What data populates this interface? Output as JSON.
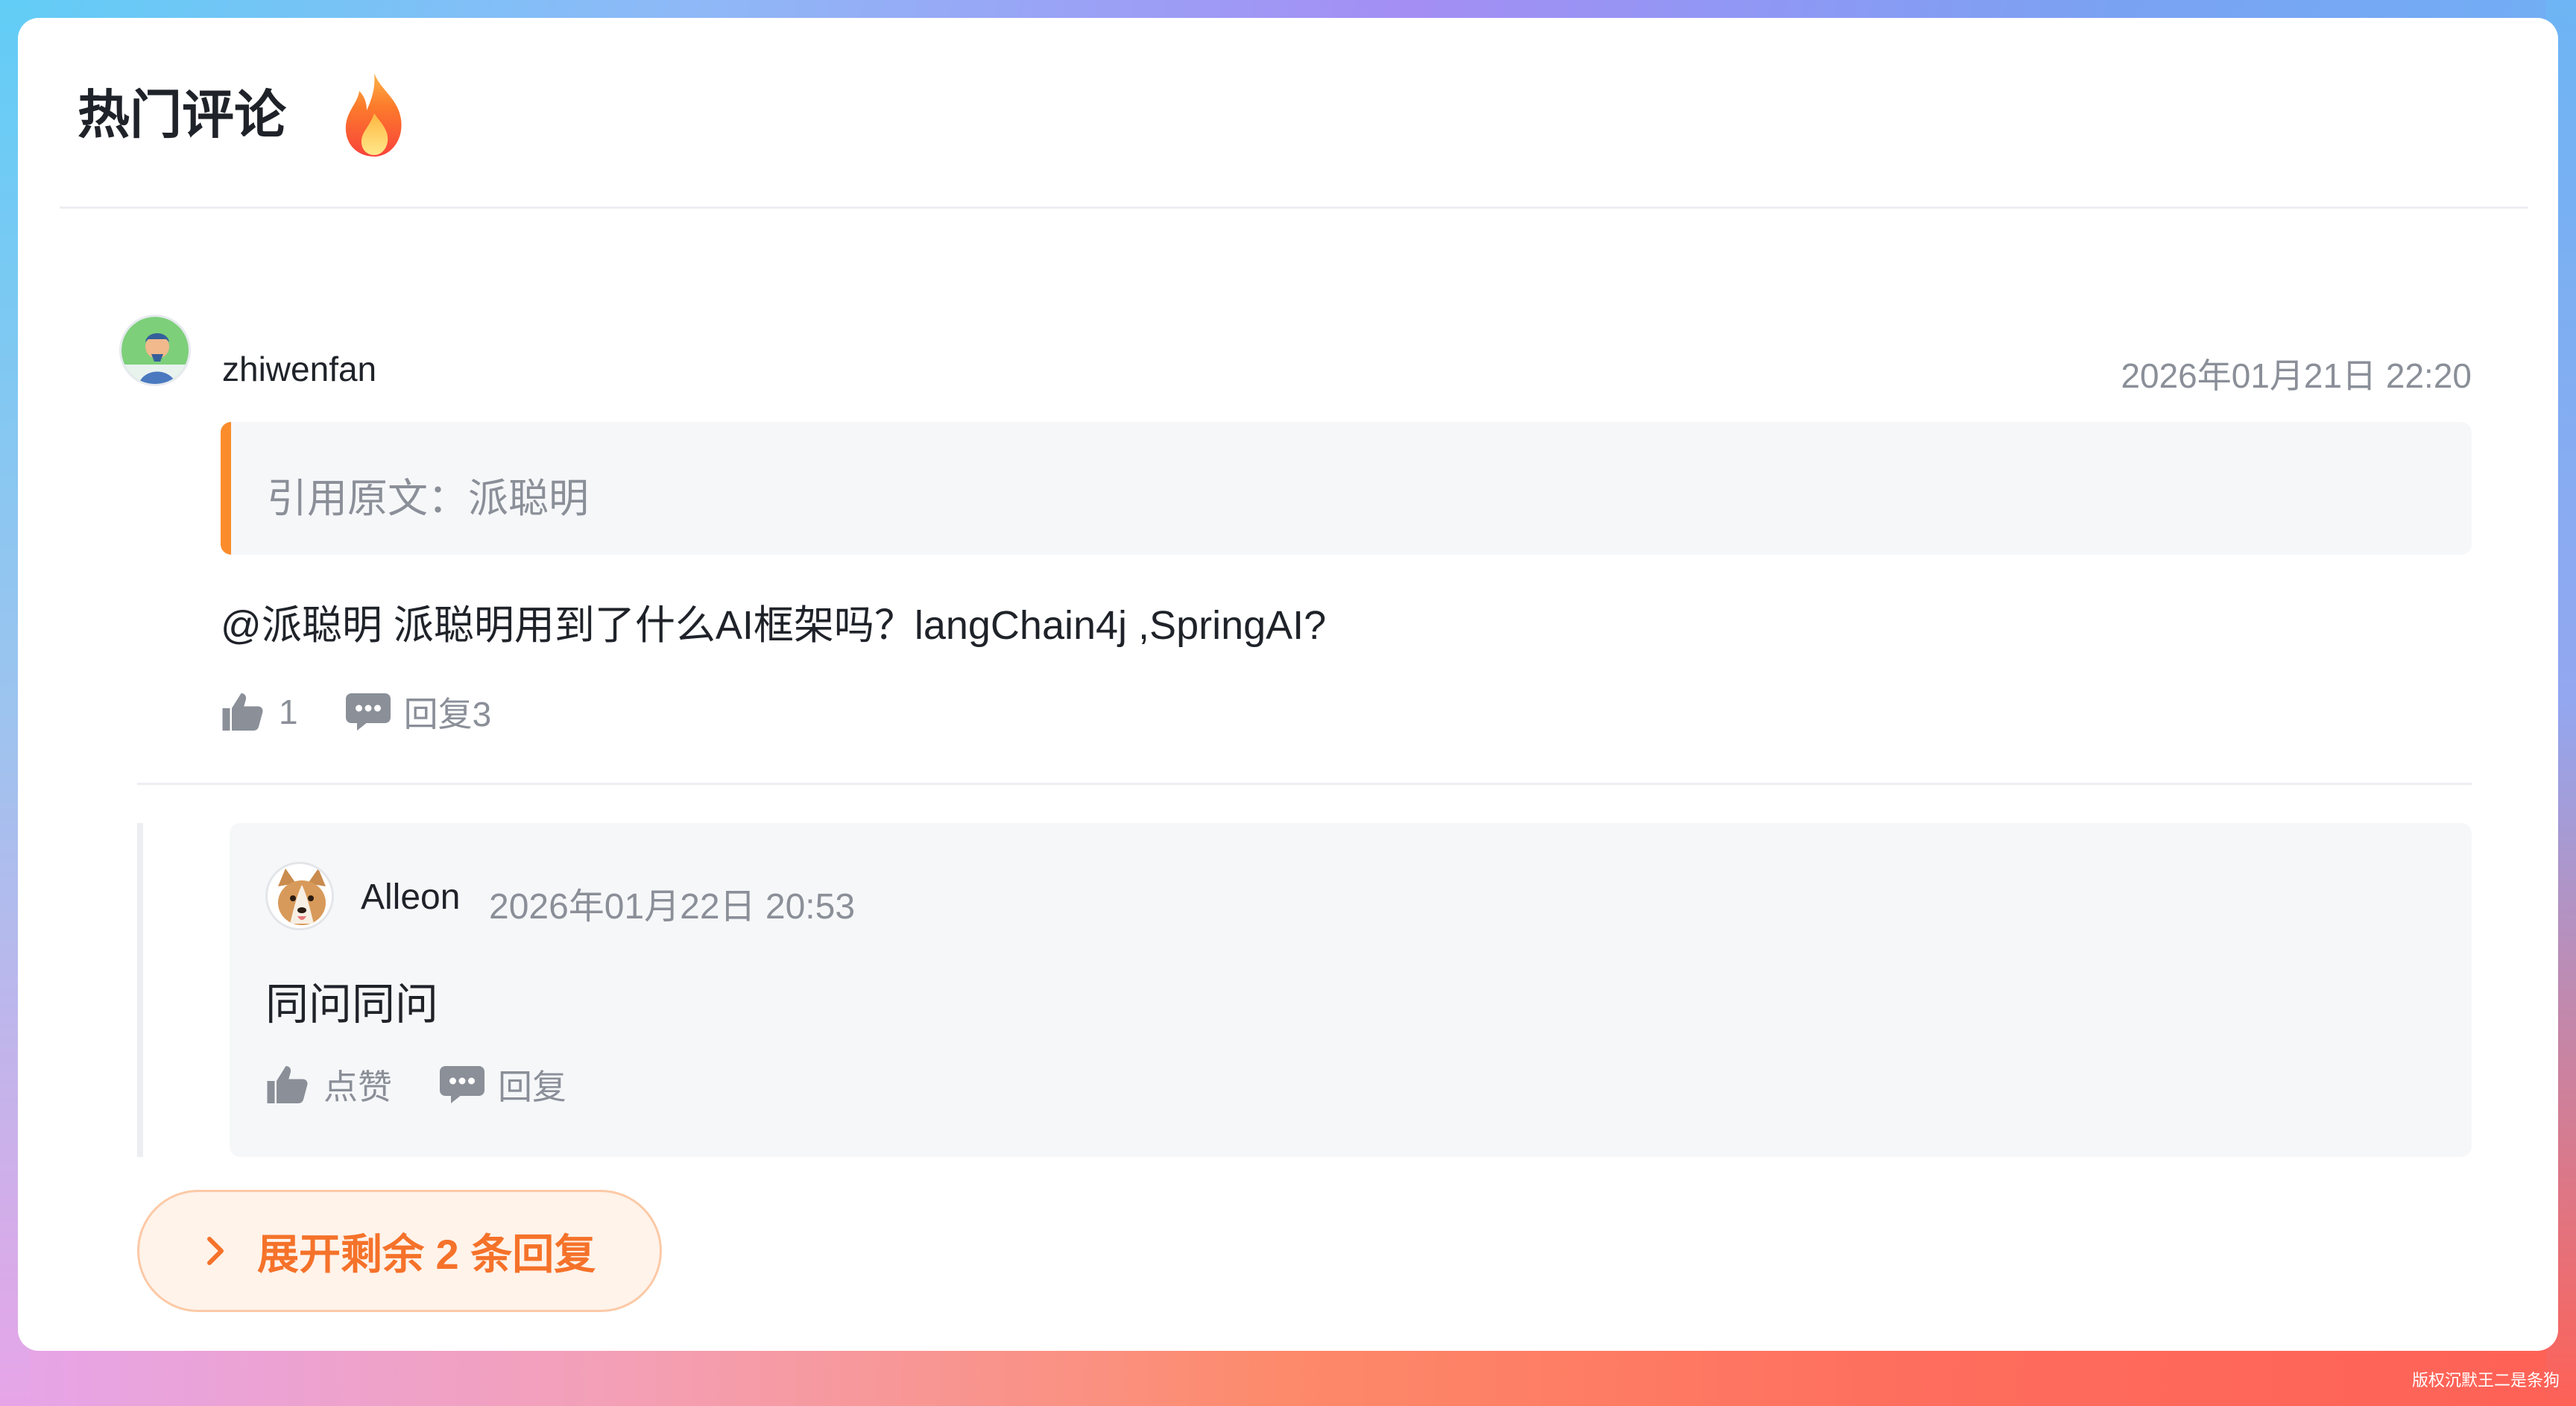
{
  "header": {
    "title": "热门评论",
    "icon": "fire-icon"
  },
  "comment": {
    "username": "zhiwenfan",
    "timestamp": "2026年01月21日 22:20",
    "quote": "引用原文：派聪明",
    "body": "@派聪明 派聪明用到了什么AI框架吗？langChain4j ,SpringAI?",
    "like_count": "1",
    "reply_label": "回复3"
  },
  "reply": {
    "username": "Alleon",
    "timestamp": "2026年01月22日 20:53",
    "body": "同问同问",
    "like_label": "点赞",
    "reply_label": "回复"
  },
  "expand": {
    "label": "展开剩余 2 条回复"
  },
  "watermark": "版权沉默王二是条狗",
  "colors": {
    "accent": "#f5722a",
    "quote_bar": "#fb8c2c",
    "muted_text": "#8a8f98"
  }
}
